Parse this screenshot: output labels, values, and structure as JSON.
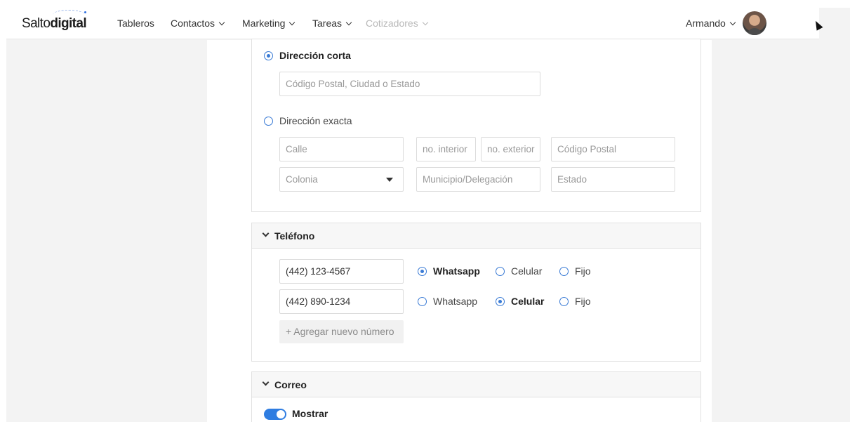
{
  "brand": {
    "name_part1": "Salto",
    "name_part2": "digital",
    "accent": "#2f6fe0"
  },
  "nav": {
    "items": [
      {
        "label": "Tableros",
        "dropdown": false,
        "disabled": false
      },
      {
        "label": "Contactos",
        "dropdown": true,
        "disabled": false
      },
      {
        "label": "Marketing",
        "dropdown": true,
        "disabled": false
      },
      {
        "label": "Tareas",
        "dropdown": true,
        "disabled": false
      },
      {
        "label": "Cotizadores",
        "dropdown": true,
        "disabled": true
      }
    ],
    "user_name": "Armando"
  },
  "address": {
    "short_option": {
      "label": "Dirección corta",
      "selected": true
    },
    "short_field": {
      "placeholder": "Código Postal, Ciudad o Estado"
    },
    "exact_option": {
      "label": "Dirección exacta",
      "selected": false
    },
    "fields": {
      "calle": "Calle",
      "interior": "no. interior",
      "exterior": "no. exterior",
      "cp": "Código Postal",
      "colonia": "Colonia",
      "municipio": "Municipio/Delegación",
      "estado": "Estado"
    }
  },
  "phone": {
    "section_title": "Teléfono",
    "numbers": [
      {
        "value": "(442) 123-4567",
        "types": [
          "Whatsapp",
          "Celular",
          "Fijo"
        ],
        "selected": "Whatsapp"
      },
      {
        "value": "(442) 890-1234",
        "types": [
          "Whatsapp",
          "Celular",
          "Fijo"
        ],
        "selected": "Celular"
      }
    ],
    "add_label": "+ Agregar nuevo número"
  },
  "email": {
    "section_title": "Correo",
    "show_toggle_label": "Mostrar",
    "show_toggle_on": true
  },
  "colors": {
    "primary": "#3a7bd5",
    "toggle": "#2f7de1",
    "page_bg": "#f3f3f3"
  }
}
